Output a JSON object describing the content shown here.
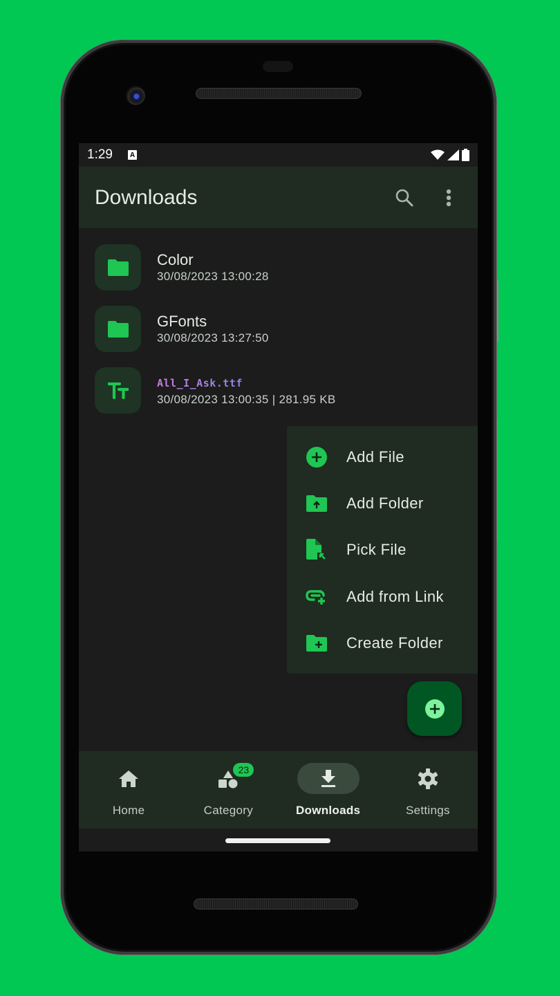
{
  "status_bar": {
    "time": "1:29",
    "notification_icon": "A",
    "icons": [
      "wifi-icon",
      "signal-icon",
      "battery-icon"
    ]
  },
  "app_bar": {
    "title": "Downloads",
    "actions": [
      "search-icon",
      "more-vert-icon"
    ]
  },
  "files": [
    {
      "name": "Color",
      "meta": "30/08/2023 13:00:28",
      "type": "folder",
      "icon": "folder-icon"
    },
    {
      "name": "GFonts",
      "meta": "30/08/2023 13:27:50",
      "type": "folder",
      "icon": "folder-icon"
    },
    {
      "name": "All_I_Ask.ttf",
      "meta": "30/08/2023 13:00:35 | 281.95 KB",
      "type": "font",
      "icon": "font-icon"
    }
  ],
  "fab_menu": {
    "items": [
      {
        "label": "Add File",
        "icon": "add-circle-icon"
      },
      {
        "label": "Add Folder",
        "icon": "folder-upload-icon"
      },
      {
        "label": "Pick File",
        "icon": "file-pick-icon"
      },
      {
        "label": "Add from Link",
        "icon": "add-link-icon"
      },
      {
        "label": "Create Folder",
        "icon": "create-folder-icon"
      }
    ]
  },
  "fab": {
    "icon": "add-circle-icon"
  },
  "bottom_nav": {
    "items": [
      {
        "label": "Home",
        "icon": "home-icon",
        "active": false
      },
      {
        "label": "Category",
        "icon": "category-icon",
        "active": false,
        "badge": "23"
      },
      {
        "label": "Downloads",
        "icon": "download-icon",
        "active": true
      },
      {
        "label": "Settings",
        "icon": "settings-icon",
        "active": false
      }
    ]
  },
  "colors": {
    "background": "#00c853",
    "accent": "#1fc653",
    "surface": "#1b1c1b",
    "surface_container": "#202b22",
    "fab": "#005723",
    "fab_icon": "#7df39b"
  }
}
